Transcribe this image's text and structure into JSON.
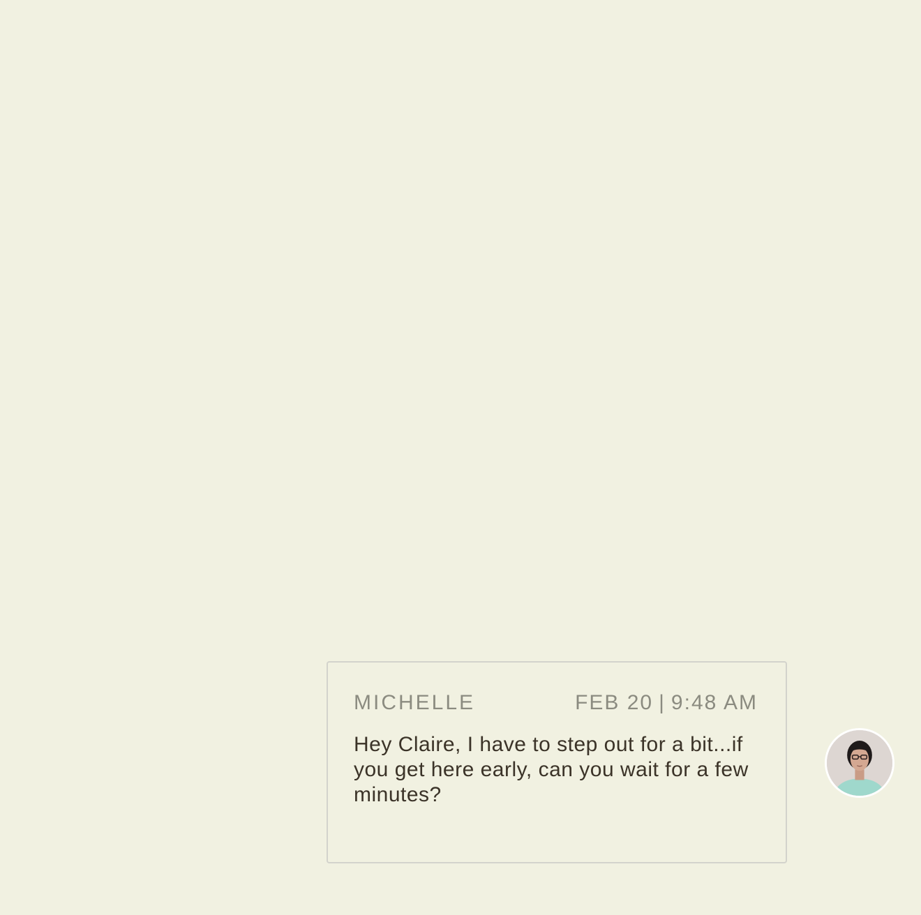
{
  "message": {
    "sender": "MICHELLE",
    "date": "FEB 20",
    "separator": "|",
    "time": "9:48 AM",
    "text": "Hey Claire, I have to step out for a bit...if you get here early, can you wait for a few minutes?"
  },
  "avatar": {
    "icon": "user-avatar-photo"
  },
  "colors": {
    "background": "#f1f1e1",
    "card_border": "#d3d3cc",
    "meta_text": "#8b8b80",
    "body_text": "#3b3328"
  }
}
